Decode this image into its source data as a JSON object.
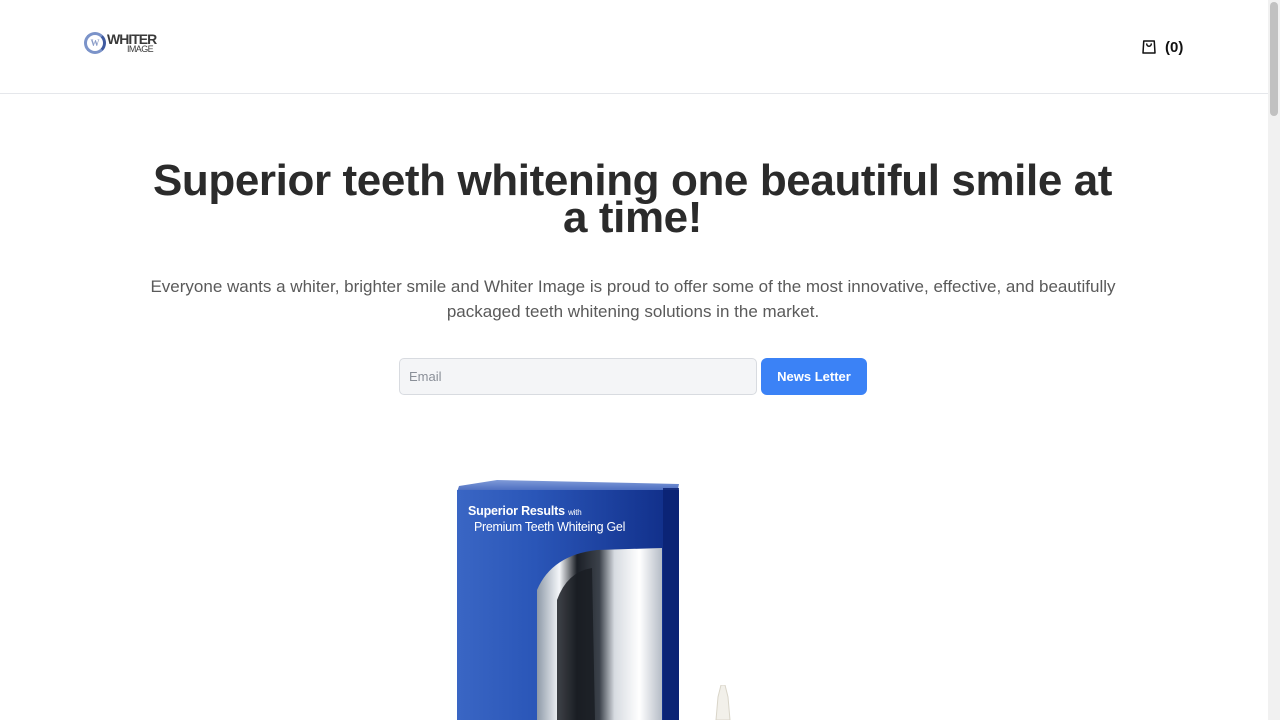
{
  "brand": {
    "logo_mark": "W",
    "logo_line1": "WHITER",
    "logo_line2": "IMAGE"
  },
  "header": {
    "cart_icon": "shopping-bag-icon",
    "cart_count": "(0)"
  },
  "hero": {
    "title": "Superior teeth whitening one beautiful smile at a time!",
    "description": "Everyone wants a whiter, brighter smile and Whiter Image is proud to offer some of the most innovative, effective, and beautifully packaged teeth whitening solutions in the market."
  },
  "newsletter": {
    "email_placeholder": "Email",
    "email_value": "",
    "button_label": "News Letter"
  },
  "product": {
    "box_line1": "Superior Results",
    "box_line1_small": "with",
    "box_line2": "Premium Teeth Whiteing Gel"
  },
  "colors": {
    "accent": "#3b82f6",
    "box_blue": "#1e3f99",
    "text_dark": "#2b2b2b",
    "text_muted": "#5a5a5a"
  }
}
